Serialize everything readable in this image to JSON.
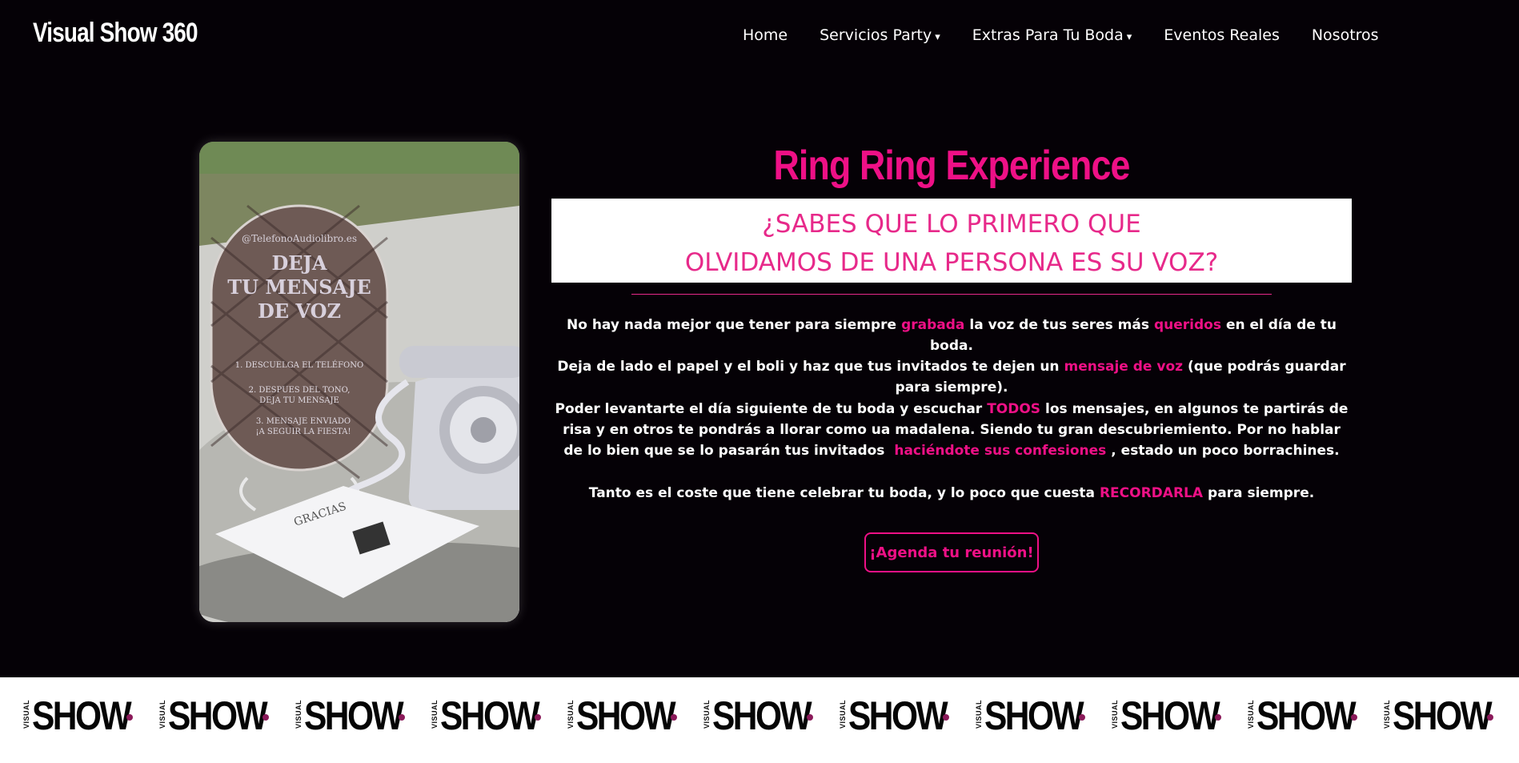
{
  "header": {
    "logo": "Visual Show 360",
    "nav": [
      {
        "label": "Home",
        "dropdown": false
      },
      {
        "label": "Servicios Party",
        "dropdown": true
      },
      {
        "label": "Extras Para Tu Boda",
        "dropdown": true
      },
      {
        "label": "Eventos Reales",
        "dropdown": false
      },
      {
        "label": "Nosotros",
        "dropdown": false
      }
    ],
    "caret": "▾"
  },
  "photo": {
    "sign_handle": "@TelefonoAudiolibro.es",
    "sign_title_1": "DEJA",
    "sign_title_2": "TU MENSAJE",
    "sign_title_3": "DE VOZ",
    "sign_step_1": "1. DESCUELGA EL TELÉFONO",
    "sign_step_2a": "2. DESPUES DEL TONO,",
    "sign_step_2b": "DEJA TU MENSAJE",
    "sign_step_3a": "3. MENSAJE ENVIADO",
    "sign_step_3b": "¡A SEGUIR LA FIESTA!",
    "card_text": "GRACIAS"
  },
  "main": {
    "title": "Ring Ring Experience",
    "question_line_1": "¿SABES QUE LO PRIMERO QUE",
    "question_line_2": "OLVIDAMOS DE UNA PERSONA ES SU VOZ?",
    "p1": {
      "a": "No hay nada mejor que tener para siempre",
      "hl1": "grabada",
      "b": "la voz de tus seres más",
      "hl2": "queridos",
      "c": "en el día de tu boda."
    },
    "p2": {
      "a": "Deja de lado el papel y el boli y haz que tus invitados te dejen un",
      "hl1": "mensaje de voz",
      "b": "(que podrás guardar para siempre)."
    },
    "p3": {
      "a": "Poder levantarte el día siguiente de tu boda y escuchar",
      "hl1": "TODOS",
      "b": "los mensajes, en algunos te partirás de risa y en otros te pondrás a llorar como ua madalena. Siendo tu gran descubriemiento. Por no hablar de lo bien que se lo pasarán tus invitados",
      "hl2": "haciéndote sus confesiones",
      "c": ", estado un poco borrachines."
    },
    "p4": {
      "a": "Tanto es el coste que tiene celebrar tu boda, y lo poco que cuesta",
      "hl1": "RECORDARLA",
      "b": "para siempre."
    },
    "cta": "¡Agenda tu reunión!"
  },
  "band": {
    "small": "VISUAL",
    "big": "SHOW",
    "count": 12
  },
  "colors": {
    "accent": "#ee1086",
    "background": "#050106"
  }
}
